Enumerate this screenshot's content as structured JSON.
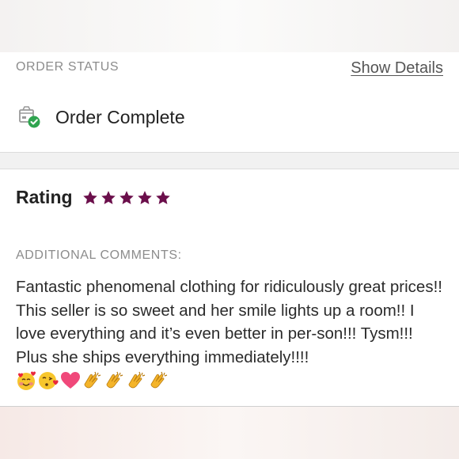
{
  "order_status": {
    "section_label": "ORDER STATUS",
    "show_details_label": "Show Details",
    "status_text": "Order Complete"
  },
  "rating": {
    "label": "Rating",
    "stars": 5,
    "star_color": "#6b0f4b"
  },
  "comments": {
    "section_label": "ADDITIONAL COMMENTS:",
    "text": "Fantastic phenomenal clothing for ridiculously great prices!! This seller is so sweet and her smile lights up a room!! I love everything and it’s even better in per-son!!! Tysm!!! Plus she ships everything immediately!!!!",
    "emojis": [
      "smiling-face-with-hearts",
      "face-blowing-kiss",
      "pink-heart",
      "clapping-hands",
      "clapping-hands",
      "clapping-hands",
      "clapping-hands"
    ]
  },
  "colors": {
    "accent_success": "#2fa44f",
    "label_gray": "#8c8c8c"
  }
}
